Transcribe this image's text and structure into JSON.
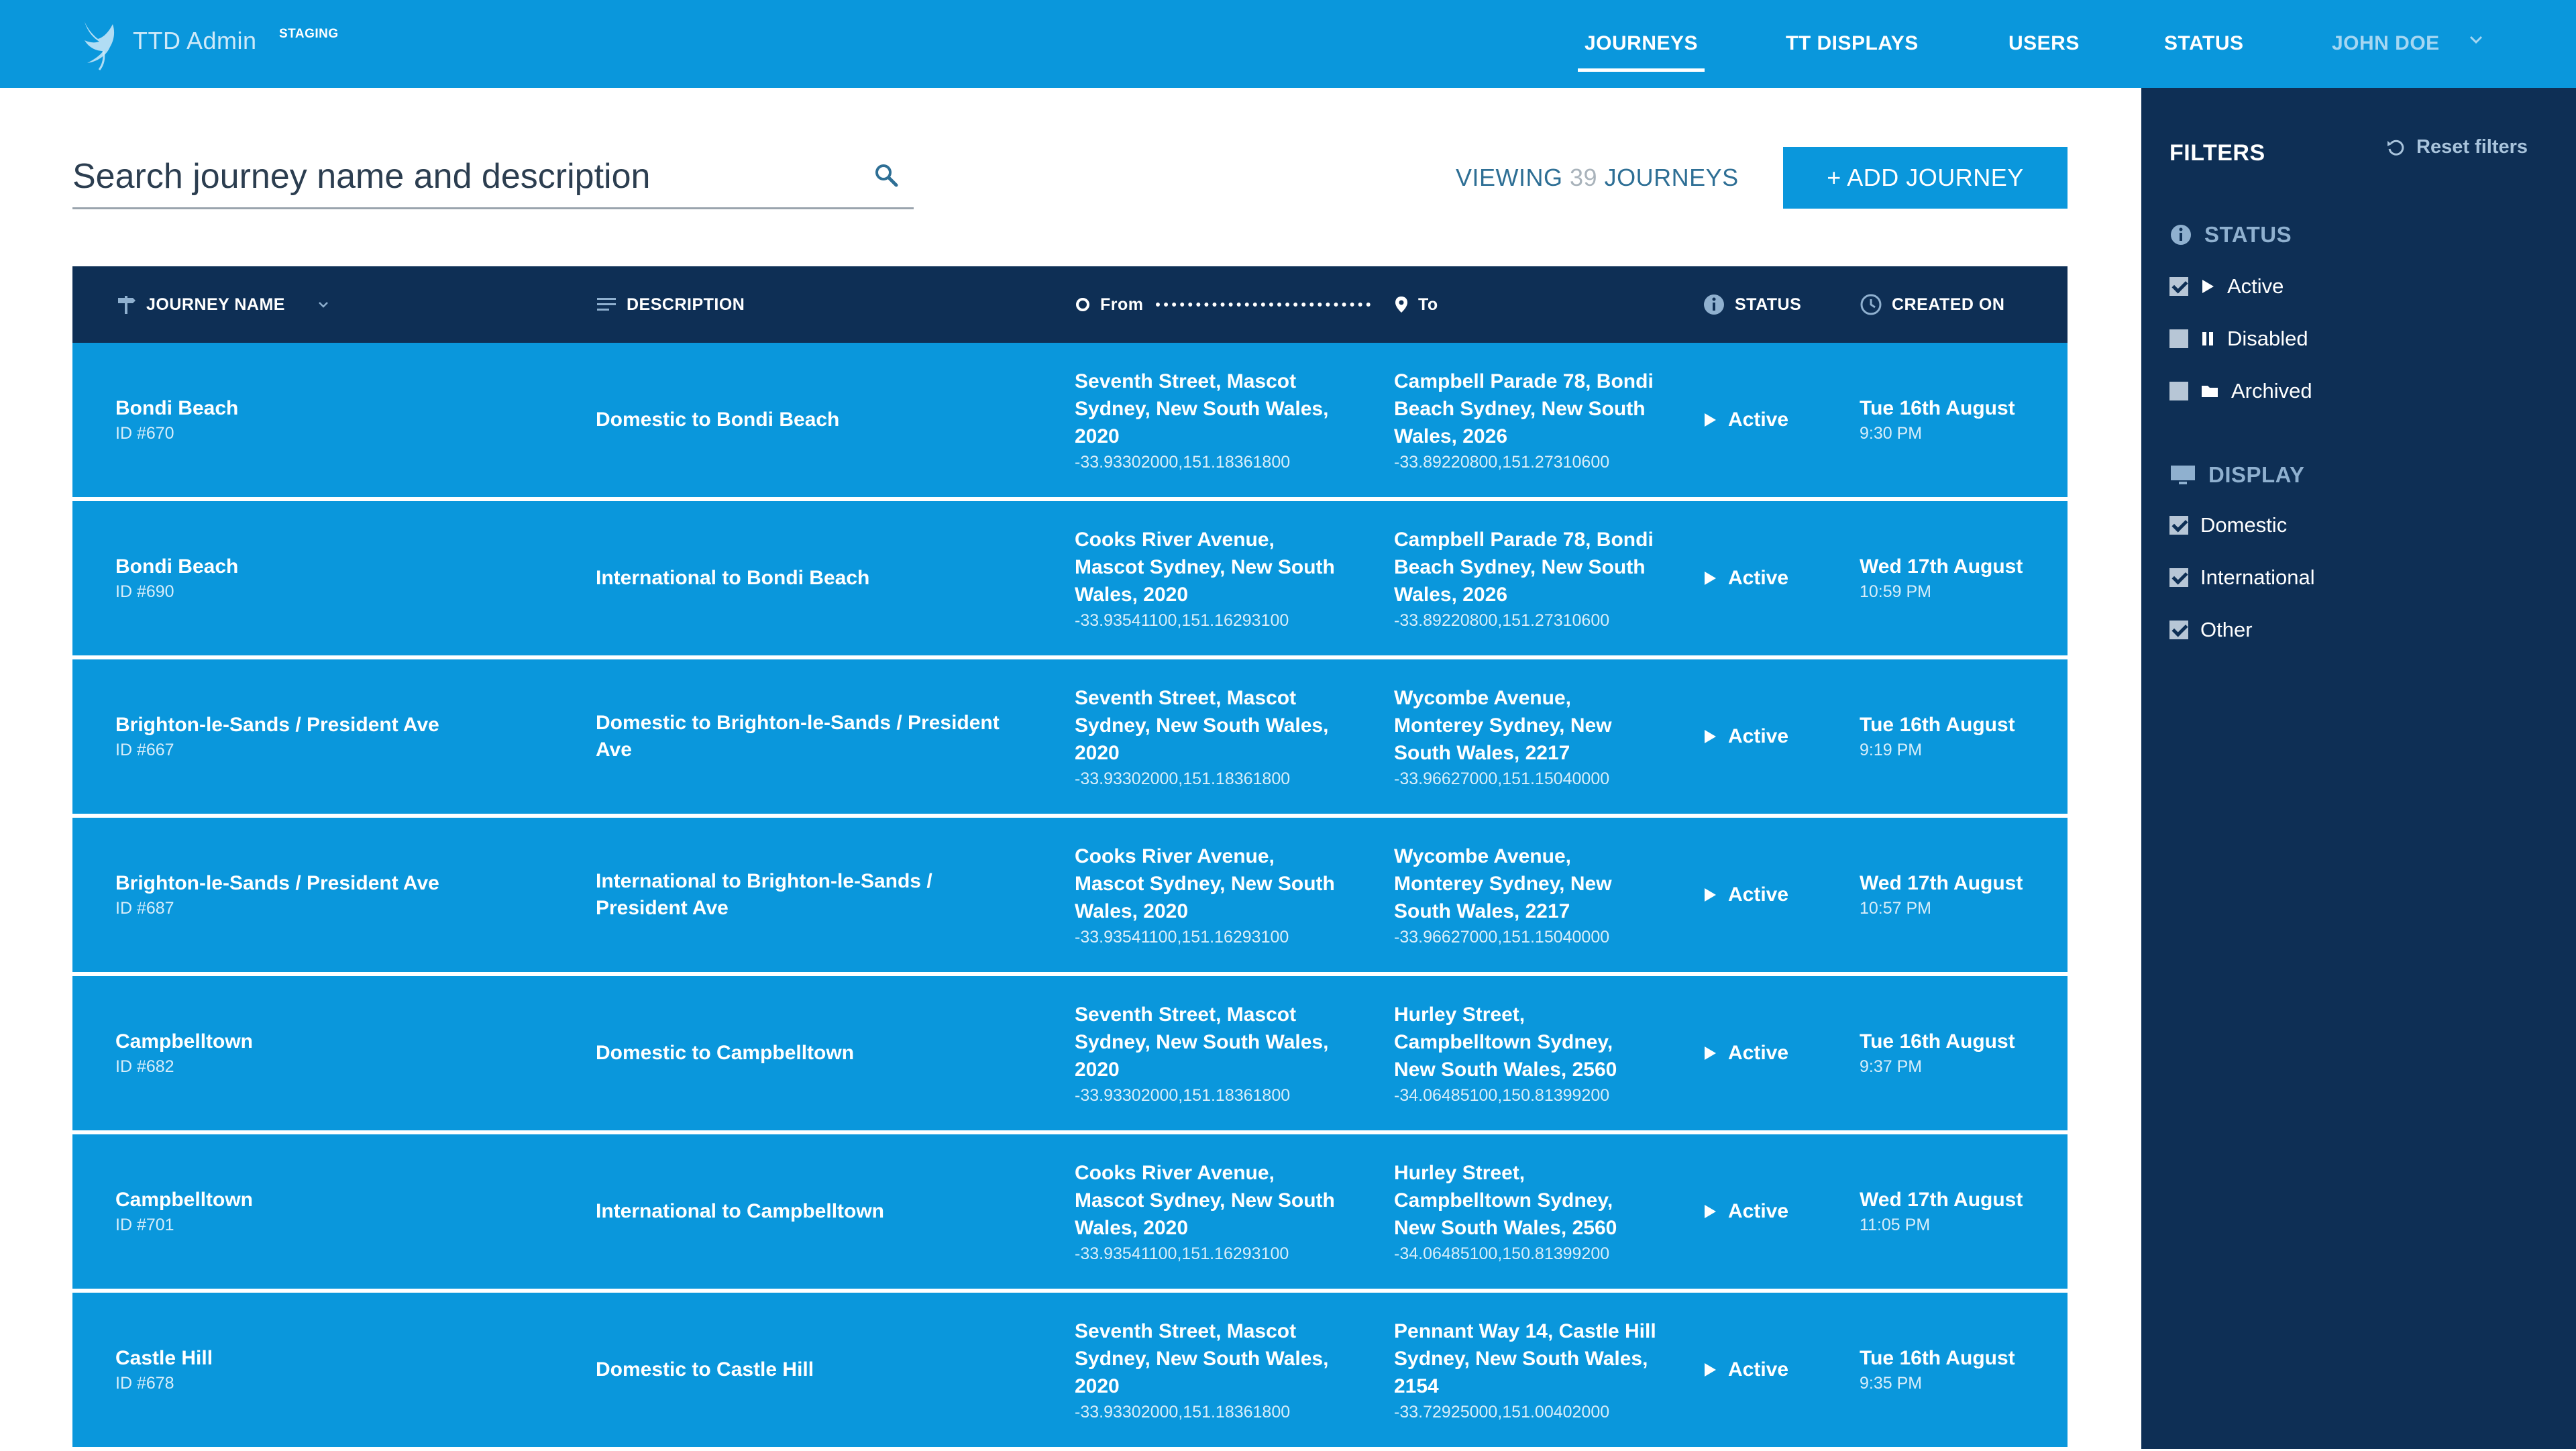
{
  "app": {
    "title": "TTD Admin",
    "env": "STAGING"
  },
  "nav": {
    "items": [
      {
        "label": "JOURNEYS",
        "active": true
      },
      {
        "label": "TT DISPLAYS",
        "active": false
      },
      {
        "label": "USERS",
        "active": false
      },
      {
        "label": "STATUS",
        "active": false
      }
    ],
    "user": "JOHN DOE"
  },
  "search": {
    "placeholder": "Search journey name and description"
  },
  "viewing": {
    "prefix": "VIEWING",
    "count": "39",
    "suffix": "JOURNEYS"
  },
  "add_button": "+ ADD JOURNEY",
  "table": {
    "headers": {
      "name": "JOURNEY NAME",
      "description": "DESCRIPTION",
      "from": "From",
      "to": "To",
      "status": "STATUS",
      "created": "CREATED ON"
    },
    "rows": [
      {
        "name": "Bondi Beach",
        "id": "ID #670",
        "description": "Domestic to Bondi Beach",
        "from": {
          "lines": [
            "Seventh Street, Mascot",
            "Sydney, New South Wales,",
            "2020"
          ],
          "coords": "-33.93302000,151.18361800"
        },
        "to": {
          "lines": [
            "Campbell Parade 78, Bondi",
            "Beach Sydney, New South",
            "Wales, 2026"
          ],
          "coords": "-33.89220800,151.27310600"
        },
        "status": "Active",
        "created_date": "Tue 16th August",
        "created_time": "9:30 PM"
      },
      {
        "name": "Bondi Beach",
        "id": "ID #690",
        "description": "International to Bondi Beach",
        "from": {
          "lines": [
            "Cooks River Avenue,",
            "Mascot Sydney, New South",
            "Wales, 2020"
          ],
          "coords": "-33.93541100,151.16293100"
        },
        "to": {
          "lines": [
            "Campbell Parade 78, Bondi",
            "Beach Sydney, New South",
            "Wales, 2026"
          ],
          "coords": "-33.89220800,151.27310600"
        },
        "status": "Active",
        "created_date": "Wed 17th August",
        "created_time": "10:59 PM"
      },
      {
        "name": "Brighton-le-Sands / President Ave",
        "id": "ID #667",
        "description": "Domestic to Brighton-le-Sands / President Ave",
        "from": {
          "lines": [
            "Seventh Street, Mascot",
            "Sydney, New South Wales,",
            "2020"
          ],
          "coords": "-33.93302000,151.18361800"
        },
        "to": {
          "lines": [
            "Wycombe Avenue,",
            "Monterey Sydney, New",
            "South Wales, 2217"
          ],
          "coords": "-33.96627000,151.15040000"
        },
        "status": "Active",
        "created_date": "Tue 16th August",
        "created_time": "9:19 PM"
      },
      {
        "name": "Brighton-le-Sands / President Ave",
        "id": "ID #687",
        "description": "International to Brighton-le-Sands / President Ave",
        "from": {
          "lines": [
            "Cooks River Avenue,",
            "Mascot Sydney, New South",
            "Wales, 2020"
          ],
          "coords": "-33.93541100,151.16293100"
        },
        "to": {
          "lines": [
            "Wycombe Avenue,",
            "Monterey Sydney, New",
            "South Wales, 2217"
          ],
          "coords": "-33.96627000,151.15040000"
        },
        "status": "Active",
        "created_date": "Wed 17th August",
        "created_time": "10:57 PM"
      },
      {
        "name": "Campbelltown",
        "id": "ID #682",
        "description": "Domestic to Campbelltown",
        "from": {
          "lines": [
            "Seventh Street, Mascot",
            "Sydney, New South Wales,",
            "2020"
          ],
          "coords": "-33.93302000,151.18361800"
        },
        "to": {
          "lines": [
            "Hurley Street,",
            "Campbelltown Sydney,",
            "New South Wales, 2560"
          ],
          "coords": "-34.06485100,150.81399200"
        },
        "status": "Active",
        "created_date": "Tue 16th August",
        "created_time": "9:37 PM"
      },
      {
        "name": "Campbelltown",
        "id": "ID #701",
        "description": "International to Campbelltown",
        "from": {
          "lines": [
            "Cooks River Avenue,",
            "Mascot Sydney, New South",
            "Wales, 2020"
          ],
          "coords": "-33.93541100,151.16293100"
        },
        "to": {
          "lines": [
            "Hurley Street,",
            "Campbelltown Sydney,",
            "New South Wales, 2560"
          ],
          "coords": "-34.06485100,150.81399200"
        },
        "status": "Active",
        "created_date": "Wed 17th August",
        "created_time": "11:05 PM"
      },
      {
        "name": "Castle Hill",
        "id": "ID #678",
        "description": "Domestic to Castle Hill",
        "from": {
          "lines": [
            "Seventh Street, Mascot",
            "Sydney, New South Wales,",
            "2020"
          ],
          "coords": "-33.93302000,151.18361800"
        },
        "to": {
          "lines": [
            "Pennant Way 14, Castle Hill",
            "Sydney, New South Wales,",
            "2154"
          ],
          "coords": "-33.72925000,151.00402000"
        },
        "status": "Active",
        "created_date": "Tue 16th August",
        "created_time": "9:35 PM"
      }
    ]
  },
  "filters": {
    "title": "FILTERS",
    "reset": "Reset filters",
    "status_title": "STATUS",
    "status_options": [
      {
        "label": "Active",
        "checked": true,
        "icon": "play-icon"
      },
      {
        "label": "Disabled",
        "checked": false,
        "icon": "pause-icon"
      },
      {
        "label": "Archived",
        "checked": false,
        "icon": "folder-icon"
      }
    ],
    "display_title": "DISPLAY",
    "display_options": [
      {
        "label": "Domestic",
        "checked": true
      },
      {
        "label": "International",
        "checked": true
      },
      {
        "label": "Other",
        "checked": true
      }
    ]
  },
  "colors": {
    "primary": "#0a97dc",
    "navy": "#0e2f55",
    "muted": "#8fb0cf"
  }
}
